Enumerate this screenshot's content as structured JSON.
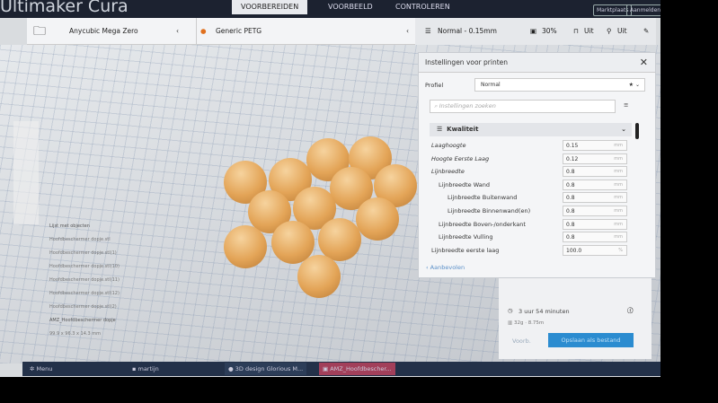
{
  "app": {
    "title": "Ultimaker Cura"
  },
  "nav": {
    "tabs": [
      "VOORBEREIDEN",
      "VOORBEELD",
      "CONTROLEREN"
    ],
    "marketplace": "Marktplaats",
    "account": "Aanmelden"
  },
  "toolbar": {
    "printer": "Anycubic Mega Zero",
    "material": "Generic PETG",
    "profile": "Normal - 0.15mm",
    "infill": "30%",
    "support": "Uit",
    "adhesion": "Uit"
  },
  "objects": {
    "title": "Lijst met objecten",
    "items": [
      "Hoofdbeschermer dopje.stl",
      "Hoofdbeschermer dopje.stl(1)",
      "Hoofdbeschermer dopje.stl(10)",
      "Hoofdbeschermer dopje.stl(11)",
      "Hoofdbeschermer dopje.stl(12)",
      "Hoofdbeschermer dopje.stl(2)"
    ],
    "selected": "AMZ_Hoofdbeschermer dopje",
    "dims": "99.9 x 96.3 x 14.3 mm"
  },
  "settings": {
    "title": "Instellingen voor printen",
    "profile_label": "Profiel",
    "profile_value": "Normal",
    "search_placeholder": "Instellingen zoeken",
    "category": "Kwaliteit",
    "rows": [
      {
        "label": "Laaghoogte",
        "value": "0.15",
        "unit": "mm"
      },
      {
        "label": "Hoogte Eerste Laag",
        "value": "0.12",
        "unit": "mm"
      },
      {
        "label": "Lijnbreedte",
        "value": "0.8",
        "unit": "mm"
      },
      {
        "label": "Lijnbreedte Wand",
        "value": "0.8",
        "unit": "mm"
      },
      {
        "label": "Lijnbreedte Buitenwand",
        "value": "0.8",
        "unit": "mm"
      },
      {
        "label": "Lijnbreedte Binnenwand(en)",
        "value": "0.8",
        "unit": "mm"
      },
      {
        "label": "Lijnbreedte Boven-/onderkant",
        "value": "0.8",
        "unit": "mm"
      },
      {
        "label": "Lijnbreedte Vulling",
        "value": "0.8",
        "unit": "mm"
      },
      {
        "label": "Lijnbreedte eerste laag",
        "value": "100.0",
        "unit": "%"
      }
    ],
    "recommended": "Aanbevolen"
  },
  "print": {
    "time": "3 uur 54 minuten",
    "material": "32g · 8.75m",
    "preview": "Voorb.",
    "save": "Opslaan als bestand"
  },
  "taskbar": {
    "menu": "Menu",
    "folder": "martijn",
    "task1": "3D design Glorious M...",
    "task2": "AMZ_Hoofdbescher..."
  }
}
